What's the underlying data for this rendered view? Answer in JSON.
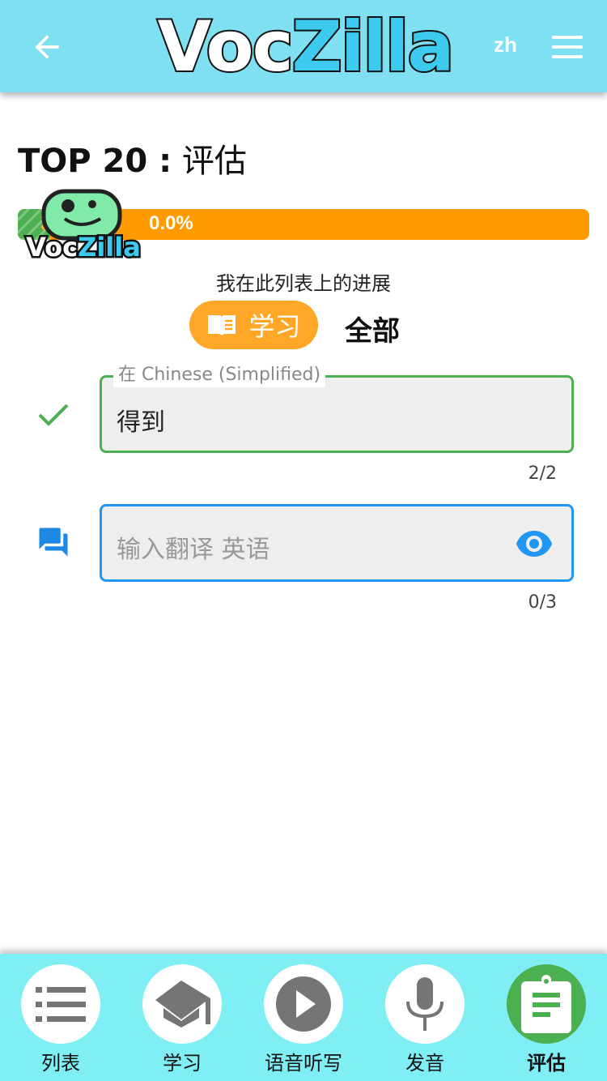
{
  "header": {
    "logo": "VocZilla",
    "logo_a": "Voc",
    "logo_b": "Zilla",
    "lang": "zh"
  },
  "title": {
    "prefix": "TOP 20 :",
    "suffix": "评估"
  },
  "progress": {
    "value": 0.0,
    "label": "0.0%",
    "caption": "我在此列表上的进展"
  },
  "filters": {
    "learn": "学习",
    "all": "全部"
  },
  "fields": [
    {
      "legend": "在 Chinese (Simplified)",
      "value": "得到",
      "count": "2/2"
    },
    {
      "placeholder": "输入翻译 英语",
      "count": "0/3"
    }
  ],
  "nav": [
    {
      "label": "列表"
    },
    {
      "label": "学习"
    },
    {
      "label": "语音听写"
    },
    {
      "label": "发音"
    },
    {
      "label": "评估"
    }
  ],
  "colors": {
    "accent": "#7ee0f0",
    "progress": "#ff9a00",
    "success": "#4caf50",
    "focus": "#2196f3"
  }
}
